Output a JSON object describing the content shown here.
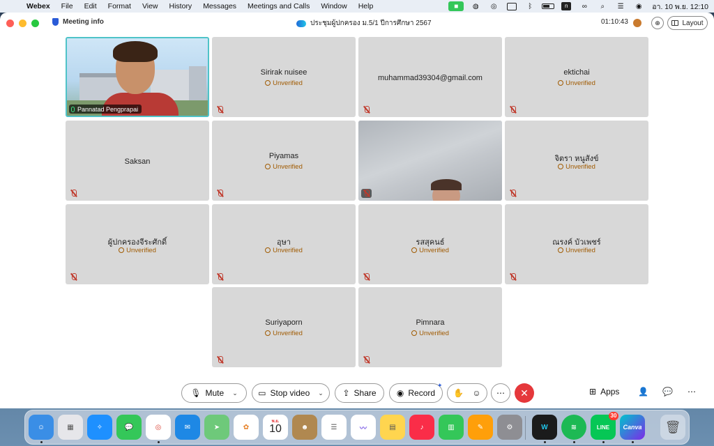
{
  "menubar": {
    "app_name": "Webex",
    "items": [
      "File",
      "Edit",
      "Format",
      "View",
      "History",
      "Messages",
      "Meetings and Calls",
      "Window",
      "Help"
    ],
    "status_icons": [
      "video-camera-icon",
      "line-icon",
      "airdrop-icon",
      "cursor-icon",
      "bluetooth-icon",
      "battery-icon",
      "n-icon",
      "link-icon",
      "search-icon",
      "control-center-icon",
      "siri-icon"
    ],
    "clock": "อา. 10 พ.ย.  12:10"
  },
  "titlebar": {
    "meeting_info": "Meeting info",
    "meeting_title": "ประชุมผู้ปกครอง ม.5/1 ปีการศึกษา 2567",
    "timer": "01:10:43",
    "layout_label": "Layout"
  },
  "participants": [
    {
      "name": "Pannatad Pengprapai",
      "status": "",
      "video": true,
      "active": true
    },
    {
      "name": "Sirirak nuisee",
      "status": "Unverified",
      "video": false
    },
    {
      "name": "muhammad39304@gmail.com",
      "status": "",
      "video": false
    },
    {
      "name": "ektichai",
      "status": "Unverified",
      "video": false
    },
    {
      "name": "Saksan",
      "status": "",
      "video": false
    },
    {
      "name": "Piyamas",
      "status": "Unverified",
      "video": false
    },
    {
      "name": "",
      "status": "",
      "video": true
    },
    {
      "name": "จิตรา หนูสังข์",
      "status": "Unverified",
      "video": false
    },
    {
      "name": "ผู้ปกครองจีระศักดิ์",
      "status": "Unverified",
      "video": false
    },
    {
      "name": "อุษา",
      "status": "Unverified",
      "video": false
    },
    {
      "name": "รสสุคนธ์",
      "status": "Unverified",
      "video": false
    },
    {
      "name": "ณรงค์ บัวเพชร์",
      "status": "Unverified",
      "video": false
    },
    {
      "name": "Suriyaporn",
      "status": "Unverified",
      "video": false
    },
    {
      "name": "Pimnara",
      "status": "Unverified",
      "video": false
    }
  ],
  "toolbar": {
    "mute_label": "Mute",
    "stop_video_label": "Stop video",
    "share_label": "Share",
    "record_label": "Record",
    "apps_label": "Apps"
  },
  "dock": {
    "apps": [
      "Finder",
      "Launchpad",
      "Safari",
      "Messages",
      "Chrome",
      "Mail",
      "Maps",
      "Photos",
      "Calendar",
      "Contacts",
      "Reminders",
      "Freeform",
      "Notes",
      "Music",
      "Numbers",
      "Pages",
      "System Settings",
      "Webex",
      "Spotify",
      "LINE",
      "Canva",
      "Trash"
    ],
    "calendar_month": "พ.ย.",
    "calendar_day": "10",
    "line_badge": "30",
    "line_label": "LINE",
    "canva_label": "Canva"
  },
  "colors": {
    "accent_active": "#4fc3c8",
    "unverified": "#a05a00",
    "end_call": "#e5383b",
    "tile_bg": "#d8d8d8"
  }
}
